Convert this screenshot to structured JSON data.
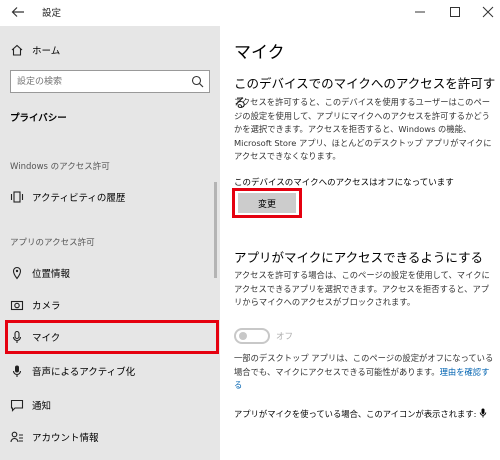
{
  "window": {
    "title": "設定",
    "back_icon": "back-arrow-icon",
    "minimize_icon": "minimize-icon",
    "maximize_icon": "maximize-icon",
    "close_icon": "close-icon"
  },
  "sidebar": {
    "home_label": "ホーム",
    "search_placeholder": "設定の検索",
    "section_title": "プライバシー",
    "group_windows": "Windows のアクセス許可",
    "group_apps": "アプリのアクセス許可",
    "items": [
      {
        "label": "アクティビティの履歴",
        "icon": "activity-history-icon"
      },
      {
        "label": "位置情報",
        "icon": "location-icon"
      },
      {
        "label": "カメラ",
        "icon": "camera-icon"
      },
      {
        "label": "マイク",
        "icon": "microphone-icon",
        "selected": true
      },
      {
        "label": "音声によるアクティブ化",
        "icon": "voice-activation-icon"
      },
      {
        "label": "通知",
        "icon": "notification-icon"
      },
      {
        "label": "アカウント情報",
        "icon": "account-info-icon"
      }
    ]
  },
  "main": {
    "title": "マイク",
    "device_heading": "このデバイスでのマイクへのアクセスを許可する",
    "device_desc": "アクセスを許可すると、このデバイスを使用するユーザーはこのページの設定を使用して、アプリにマイクへのアクセスを許可するかどうかを選択できます。アクセスを拒否すると、Windows の機能、Microsoft Store アプリ、ほとんどのデスクトップ アプリがマイクにアクセスできなくなります。",
    "status_text": "このデバイスのマイクへのアクセスはオフになっています",
    "change_button": "変更",
    "apps_heading": "アプリがマイクにアクセスできるようにする",
    "apps_desc": "アクセスを許可する場合は、このページの設定を使用して、マイクにアクセスできるアプリを選択できます。アクセスを拒否すると、アプリからマイクへのアクセスがブロックされます。",
    "toggle_state": "オフ",
    "desktop_note": "一部のデスクトップ アプリは、このページの設定がオフになっている場合でも、マイクにアクセスできる可能性があります。",
    "desktop_note_link": "理由を確認する",
    "icon_note": "アプリがマイクを使っている場合、このアイコンが表示されます:"
  },
  "colors": {
    "sidebar_bg": "#e6e6e6",
    "highlight_red": "#e5000f",
    "link_blue": "#0063b1",
    "button_gray": "#cccccc"
  }
}
